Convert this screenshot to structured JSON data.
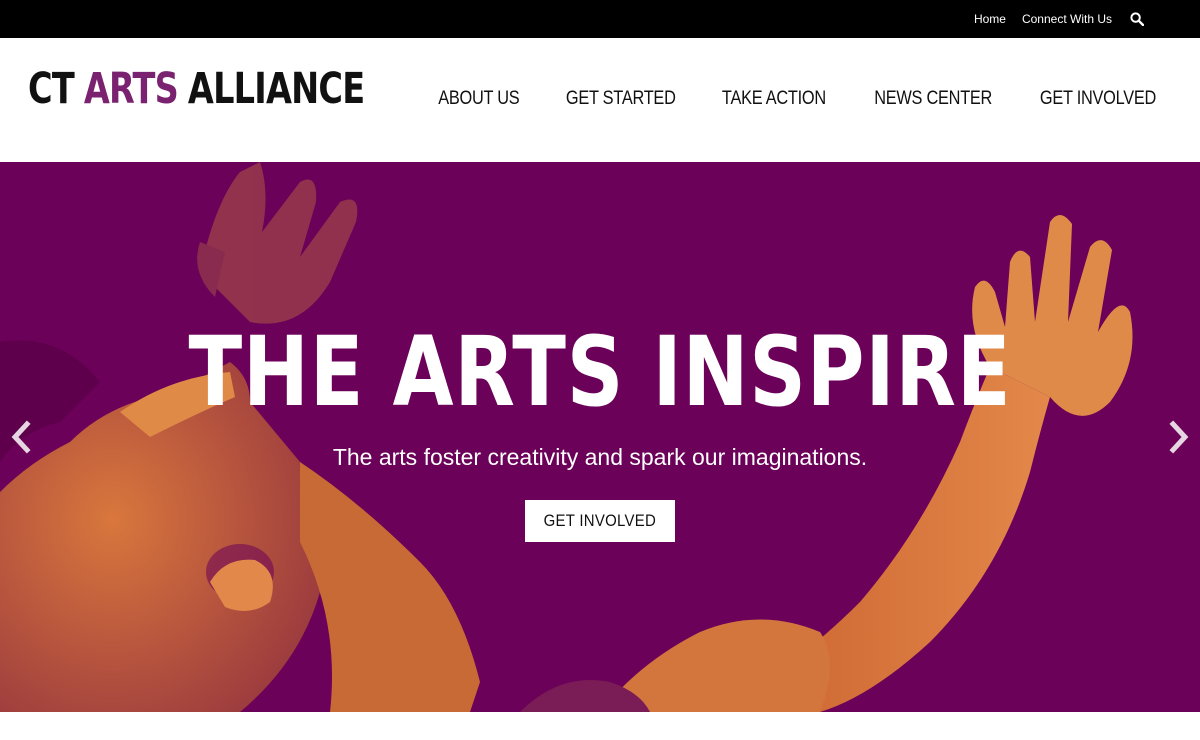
{
  "topbar": {
    "links": [
      {
        "label": "Home"
      },
      {
        "label": "Connect With Us"
      }
    ],
    "search_icon": "search-icon"
  },
  "header": {
    "logo": {
      "ct": "CT",
      "arts": "ARTS",
      "alliance": "ALLIANCE"
    },
    "nav": [
      {
        "label": "ABOUT US"
      },
      {
        "label": "GET STARTED"
      },
      {
        "label": "TAKE ACTION"
      },
      {
        "label": "NEWS CENTER"
      },
      {
        "label": "GET INVOLVED"
      }
    ]
  },
  "hero": {
    "title": "THE ARTS INSPIRE",
    "subtitle": "The arts foster creativity and spark our imaginations.",
    "button_label": "GET INVOLVED",
    "prev_icon": "chevron-left-icon",
    "next_icon": "chevron-right-icon"
  },
  "colors": {
    "topbar_bg": "#000000",
    "brand_purple": "#6b0158",
    "logo_accent": "#7a2170",
    "photo_orange": "#d8743a"
  }
}
